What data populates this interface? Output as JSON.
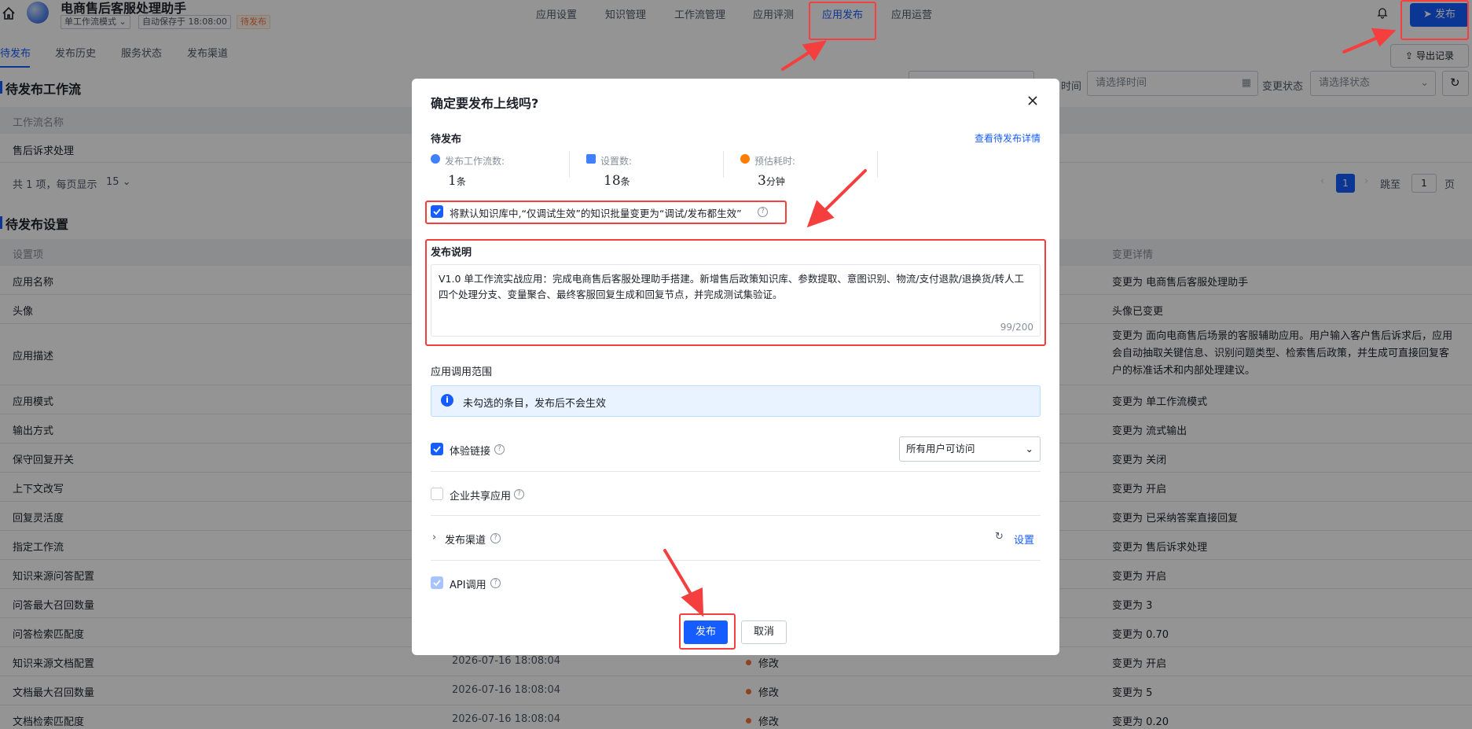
{
  "header": {
    "app_title": "电商售后客服处理助手",
    "mode_label": "单工作流模式",
    "autosave": "自动保存于 18:08:00",
    "status_badge": "待发布",
    "nav": [
      "应用设置",
      "知识管理",
      "工作流管理",
      "应用评测",
      "应用发布",
      "应用运营"
    ],
    "active_nav": "应用发布",
    "publish_button": "发布",
    "export_button": "导出记录"
  },
  "subtabs": [
    "待发布",
    "发布历史",
    "服务状态",
    "发布渠道"
  ],
  "filters": {
    "time_label": "时间",
    "time_placeholder": "请选择时间",
    "status_label": "变更状态",
    "status_placeholder": "请选择状态"
  },
  "workflow_section": {
    "title": "待发布工作流",
    "column": "工作流名称",
    "rows": [
      "售后诉求处理"
    ],
    "pagination": {
      "summary": "共 1 项，每页显示",
      "page_size": "15",
      "current_page": "1",
      "jump_label": "跳至",
      "jump_value": "1",
      "page_suffix": "页"
    }
  },
  "settings_section": {
    "title": "待发布设置",
    "columns": {
      "item": "设置项",
      "detail": "变更详情"
    },
    "rows": [
      {
        "item": "应用名称",
        "time": "",
        "status": "",
        "detail": "变更为 电商售后客服处理助手"
      },
      {
        "item": "头像",
        "time": "",
        "status": "",
        "detail": "头像已变更"
      },
      {
        "item": "应用描述",
        "time": "",
        "status": "",
        "detail": "变更为 面向电商售后场景的客服辅助应用。用户输入客户售后诉求后，应用会自动抽取关键信息、识别问题类型、检索售后政策，并生成可直接回复客户的标准话术和内部处理建议。"
      },
      {
        "item": "应用模式",
        "time": "",
        "status": "",
        "detail": "变更为 单工作流模式"
      },
      {
        "item": "输出方式",
        "time": "",
        "status": "",
        "detail": "变更为 流式输出"
      },
      {
        "item": "保守回复开关",
        "time": "",
        "status": "",
        "detail": "变更为 关闭"
      },
      {
        "item": "上下文改写",
        "time": "",
        "status": "",
        "detail": "变更为 开启"
      },
      {
        "item": "回复灵活度",
        "time": "",
        "status": "",
        "detail": "变更为 已采纳答案直接回复"
      },
      {
        "item": "指定工作流",
        "time": "",
        "status": "",
        "detail": "变更为 售后诉求处理"
      },
      {
        "item": "知识来源问答配置",
        "time": "",
        "status": "",
        "detail": "变更为 开启"
      },
      {
        "item": "问答最大召回数量",
        "time": "",
        "status": "",
        "detail": "变更为 3"
      },
      {
        "item": "问答检索匹配度",
        "time": "",
        "status": "",
        "detail": "变更为 0.70"
      },
      {
        "item": "知识来源文档配置",
        "time": "2026-07-16 18:08:04",
        "status": "修改",
        "detail": "变更为 开启"
      },
      {
        "item": "文档最大召回数量",
        "time": "2026-07-16 18:08:04",
        "status": "修改",
        "detail": "变更为 5"
      },
      {
        "item": "文档检索匹配度",
        "time": "2026-07-16 18:08:04",
        "status": "修改",
        "detail": "变更为 0.20"
      }
    ]
  },
  "modal": {
    "title": "确定要发布上线吗?",
    "pending_label": "待发布",
    "detail_link": "查看待发布详情",
    "stats": [
      {
        "label": "发布工作流数:",
        "value": "1",
        "unit": "条"
      },
      {
        "label": "设置数:",
        "value": "18",
        "unit": "条"
      },
      {
        "label": "预估耗时:",
        "value": "3",
        "unit": "分钟"
      }
    ],
    "kb_checkbox": {
      "checked": true,
      "label": "将默认知识库中,“仅调试生效”的知识批量变更为“调试/发布都生效”"
    },
    "desc_label": "发布说明",
    "desc_text": "V1.0 单工作流实战应用：完成电商售后客服处理助手搭建。新增售后政策知识库、参数提取、意图识别、物流/支付退款/退换货/转人工四个处理分支、变量聚合、最终客服回复生成和回复节点，并完成测试集验证。",
    "desc_count": "99/200",
    "scope_label": "应用调用范围",
    "info_text": "未勾选的条目，发布后不会生效",
    "options": [
      {
        "label": "体验链接",
        "checked": true
      },
      {
        "label": "企业共享应用",
        "checked": false
      },
      {
        "label": "发布渠道",
        "checked": null
      },
      {
        "label": "API调用",
        "checked": true
      }
    ],
    "access_select": "所有用户可访问",
    "channel_settings": "设置",
    "confirm_button": "发布",
    "cancel_button": "取消"
  },
  "colors": {
    "primary": "#165dff",
    "highlight": "#f53f3f",
    "warning": "#f77234"
  }
}
